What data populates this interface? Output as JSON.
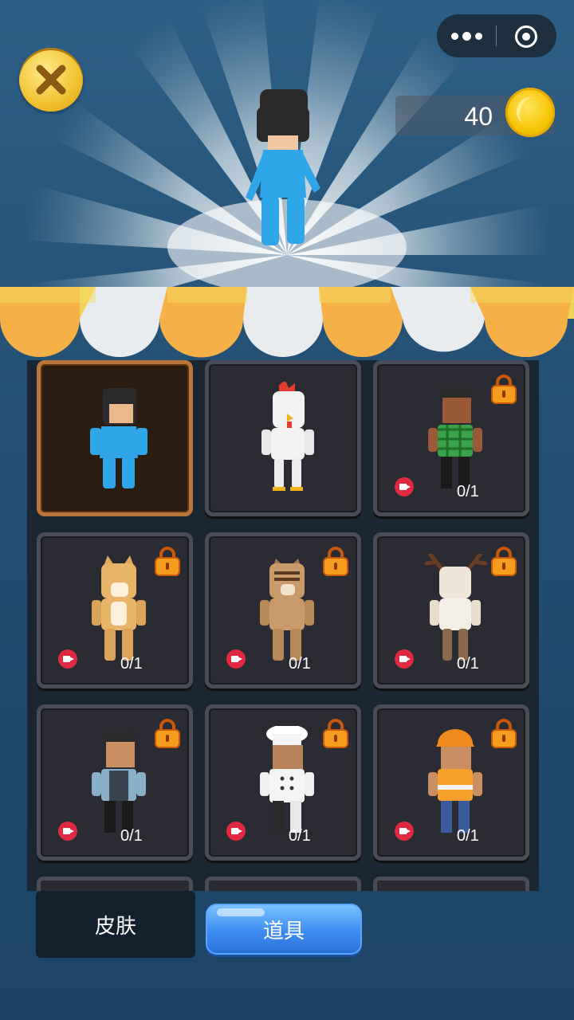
{
  "header": {
    "close_icon": "close-x-icon",
    "coins": "40",
    "coin_icon": "gold-coin-icon",
    "capsule": {
      "more_icon": "more-dots-icon",
      "target_icon": "miniprogram-close-icon"
    }
  },
  "shop": {
    "items": [
      {
        "name": "blue-suit",
        "selected": true,
        "locked": false
      },
      {
        "name": "chicken",
        "selected": false,
        "locked": false
      },
      {
        "name": "green-shirt",
        "selected": false,
        "locked": true,
        "progress": "0/1"
      },
      {
        "name": "cat",
        "selected": false,
        "locked": true,
        "progress": "0/1"
      },
      {
        "name": "chipmunk",
        "selected": false,
        "locked": true,
        "progress": "0/1"
      },
      {
        "name": "deer",
        "selected": false,
        "locked": true,
        "progress": "0/1"
      },
      {
        "name": "waiter",
        "selected": false,
        "locked": true,
        "progress": "0/1"
      },
      {
        "name": "chef",
        "selected": false,
        "locked": true,
        "progress": "0/1"
      },
      {
        "name": "builder",
        "selected": false,
        "locked": true,
        "progress": "0/1"
      }
    ]
  },
  "tabs": {
    "skin": "皮肤",
    "item": "道具"
  },
  "colors": {
    "selected_border": "#b9753a",
    "tab_active": "#3d8cf0",
    "coin": "#f5c200"
  }
}
